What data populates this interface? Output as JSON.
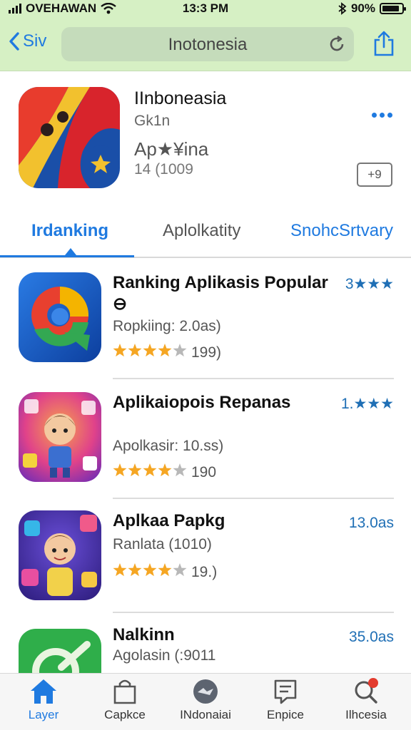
{
  "status": {
    "carrier": "OVEHAWAN",
    "time": "13:3 PM",
    "battery": "90%",
    "battery_level": 0.9
  },
  "browser": {
    "back_label": "Siv",
    "url": "Inotonesia"
  },
  "app": {
    "title": "IInboneasia",
    "subtitle": "Gk1n",
    "category": "Ap★¥ina",
    "rating_text": "14 (1009",
    "age_badge": "+9"
  },
  "tabs": [
    {
      "label": "Irdanking"
    },
    {
      "label": "Aplolkatity"
    },
    {
      "label": "SnohcSrtvary"
    }
  ],
  "list": [
    {
      "title": "Ranking Aplikasis Popular ⊖",
      "meta": "Ropkiing: 2.0as)",
      "stars": 4,
      "count": "199)",
      "side": "3★★★"
    },
    {
      "title": "Aplikaiopois Repanas",
      "meta": "Apolkasir: 10.ss)",
      "stars": 4,
      "count": "190",
      "side": "1.★★★"
    },
    {
      "title": "Aplkaa Papkg",
      "meta": "Ranlata (1010)",
      "stars": 4,
      "count": "19.)",
      "side": "13.0as"
    },
    {
      "title": "Nalkinn",
      "meta": "Agolasin (:9011",
      "stars": 0,
      "count": "",
      "side": "35.0as"
    }
  ],
  "bottom_tabs": [
    {
      "label": "Layer",
      "icon": "home-icon"
    },
    {
      "label": "Capkce",
      "icon": "bag-icon"
    },
    {
      "label": "INdonaiai",
      "icon": "globe-icon"
    },
    {
      "label": "Enpice",
      "icon": "list-icon"
    },
    {
      "label": "Ilhcesia",
      "icon": "search-icon"
    }
  ],
  "colors": {
    "accent": "#1f7ae0",
    "header_bg": "#d6f0c4",
    "star": "#f5a623"
  }
}
